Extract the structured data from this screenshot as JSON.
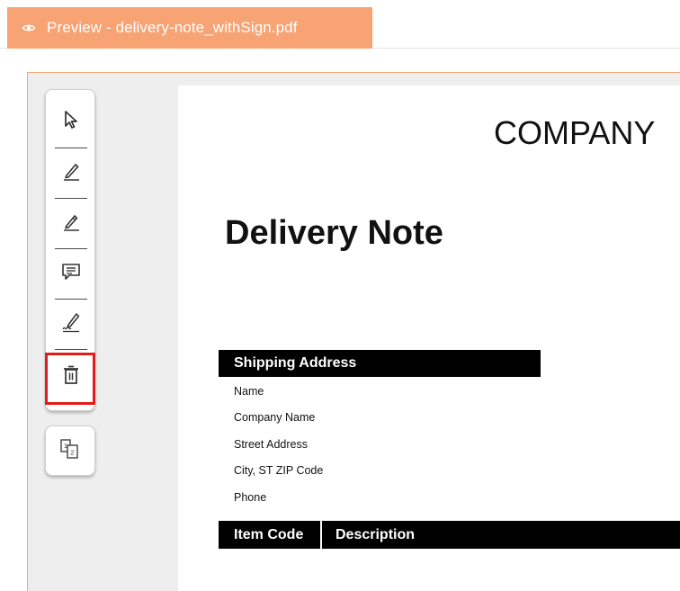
{
  "tab": {
    "title": "Preview - delivery-note_withSign.pdf",
    "icon": "eye-icon",
    "color": "#f7a374"
  },
  "toolbar": {
    "tools": [
      {
        "name": "select-tool",
        "icon": "cursor-arrow-icon"
      },
      {
        "name": "pen-tool",
        "icon": "pencil-icon"
      },
      {
        "name": "highlight-tool",
        "icon": "pencil-outline-icon"
      },
      {
        "name": "comment-tool",
        "icon": "comment-icon"
      },
      {
        "name": "signature-tool",
        "icon": "signature-pen-icon"
      },
      {
        "name": "delete-tool",
        "icon": "trash-icon"
      }
    ],
    "highlighted_tool": "delete-tool",
    "highlight_color": "#e01c1c"
  },
  "page_nav": {
    "icon": "page-numbers-icon",
    "labels": [
      "1",
      "2"
    ]
  },
  "document": {
    "company": "COMPANY",
    "title": "Delivery Note",
    "shipping": {
      "header": "Shipping Address",
      "lines": [
        "Name",
        "Company Name",
        "Street Address",
        "City, ST  ZIP Code",
        "Phone"
      ]
    },
    "table": {
      "columns": [
        "Item Code",
        "Description"
      ]
    }
  }
}
